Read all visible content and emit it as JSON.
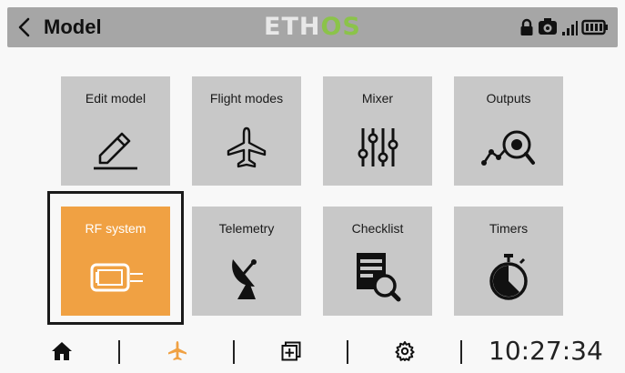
{
  "header": {
    "title": "Model",
    "logo_main": "ETH",
    "logo_accent": "OS",
    "status_icons": [
      "lock-icon",
      "model-gear-icon",
      "signal-bars-icon",
      "battery-icon"
    ]
  },
  "tiles": [
    {
      "label": "Edit model",
      "icon": "pencil-icon"
    },
    {
      "label": "Flight modes",
      "icon": "airplane-icon"
    },
    {
      "label": "Mixer",
      "icon": "sliders-icon"
    },
    {
      "label": "Outputs",
      "icon": "outputs-graph-icon"
    },
    {
      "label": "RF system",
      "icon": "rf-module-icon",
      "selected": true
    },
    {
      "label": "Telemetry",
      "icon": "satellite-dish-icon"
    },
    {
      "label": "Checklist",
      "icon": "checklist-icon"
    },
    {
      "label": "Timers",
      "icon": "stopwatch-icon"
    }
  ],
  "bottom_bar": {
    "items": [
      "home-icon",
      "airplane-icon",
      "add-window-icon",
      "gear-icon"
    ],
    "active_item": "airplane-icon",
    "clock": "10:27:34"
  },
  "colors": {
    "accent": "#f0a143",
    "logo_green": "#8bc34a",
    "tile_bg": "#c8c8c8",
    "header_bg": "#a6a6a6"
  }
}
